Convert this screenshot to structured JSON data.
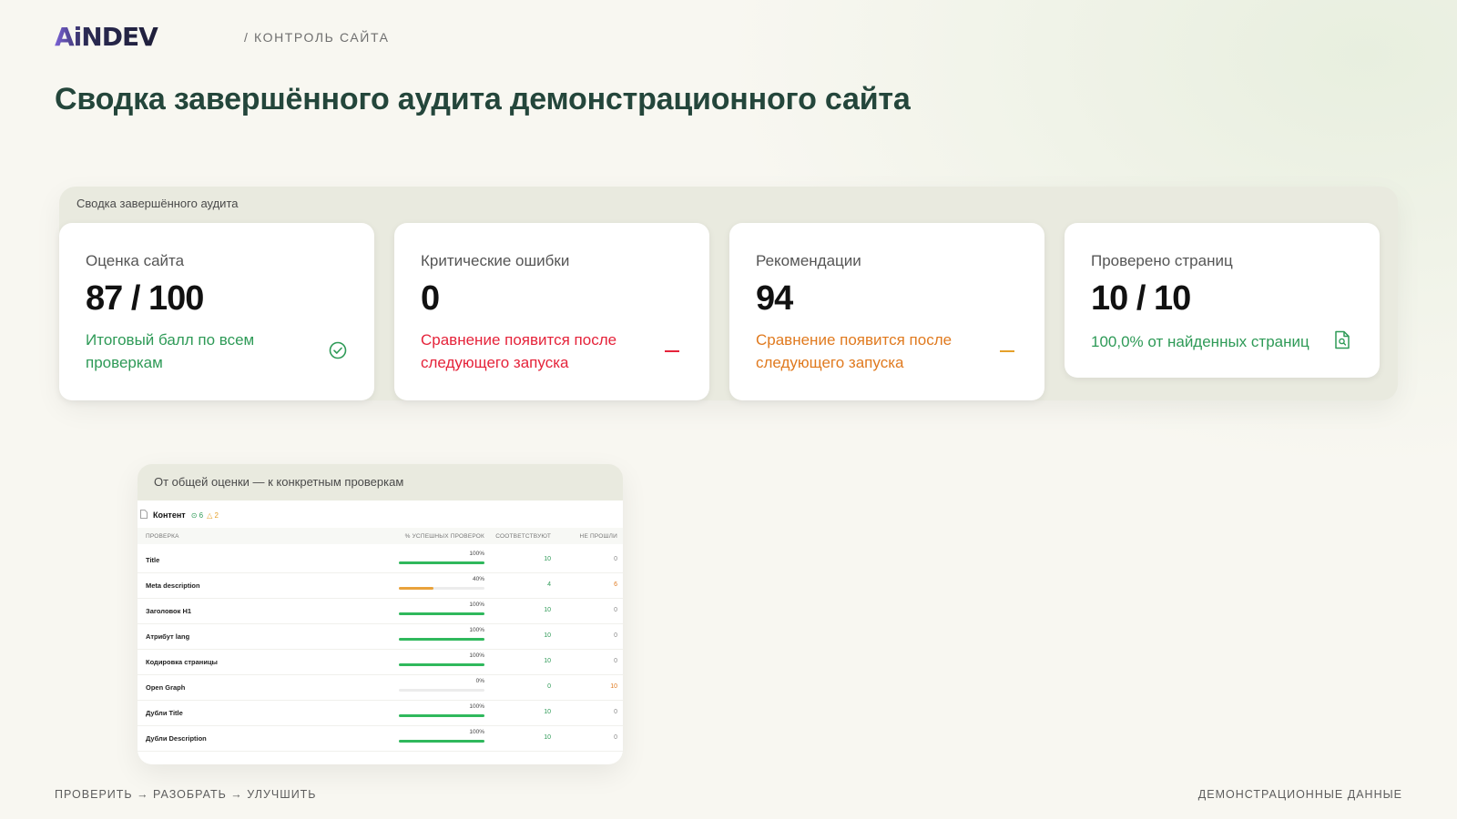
{
  "brand": {
    "logo_text": "AiNDEV",
    "section": "/ КОНТРОЛЬ САЙТА"
  },
  "page": {
    "title": "Сводка завершённого аудита демонстрационного сайта"
  },
  "summary": {
    "label": "Сводка завершённого аудита",
    "cards": [
      {
        "title": "Оценка сайта",
        "value": "87 / 100",
        "note": "Итоговый балл по всем проверкам",
        "icon": "check-circle-icon",
        "tone": "#2e9a57"
      },
      {
        "title": "Критические ошибки",
        "value": "0",
        "note": "Сравнение появится после следующего запуска",
        "icon": "dash-icon",
        "tone": "#e5233a"
      },
      {
        "title": "Рекомендации",
        "value": "94",
        "note": "Сравнение появится после следующего запуска",
        "icon": "dash-icon",
        "tone": "#e5a02a"
      },
      {
        "title": "Проверено страниц",
        "value": "10 / 10",
        "note": "100,0% от найденных страниц",
        "icon": "document-search-icon",
        "tone": "#2e9a57"
      }
    ]
  },
  "preview": {
    "label": "От общей оценки — к конкретным проверкам",
    "section": {
      "name": "Контент",
      "ok_count": "6",
      "warn_count": "2"
    },
    "columns": {
      "check": "Проверка",
      "percent": "% успешных проверок",
      "match": "Соответствуют",
      "fail": "Не прошли"
    },
    "rows": [
      {
        "name": "Title",
        "pct": "100%",
        "fill": 1.0,
        "match": "10",
        "fail": "0",
        "color": "#2fb85c"
      },
      {
        "name": "Meta description",
        "pct": "40%",
        "fill": 0.4,
        "match": "4",
        "fail": "6",
        "color": "#e9a23b"
      },
      {
        "name": "Заголовок H1",
        "pct": "100%",
        "fill": 1.0,
        "match": "10",
        "fail": "0",
        "color": "#2fb85c"
      },
      {
        "name": "Атрибут lang",
        "pct": "100%",
        "fill": 1.0,
        "match": "10",
        "fail": "0",
        "color": "#2fb85c"
      },
      {
        "name": "Кодировка страницы",
        "pct": "100%",
        "fill": 1.0,
        "match": "10",
        "fail": "0",
        "color": "#2fb85c"
      },
      {
        "name": "Open Graph",
        "pct": "0%",
        "fill": 0.0,
        "match": "0",
        "fail": "10",
        "color": "#2fb85c"
      },
      {
        "name": "Дубли Title",
        "pct": "100%",
        "fill": 1.0,
        "match": "10",
        "fail": "0",
        "color": "#2fb85c"
      },
      {
        "name": "Дубли Description",
        "pct": "100%",
        "fill": 1.0,
        "match": "10",
        "fail": "0",
        "color": "#2fb85c"
      }
    ]
  },
  "footer": {
    "left": "ПРОВЕРИТЬ → РАЗОБРАТЬ → УЛУЧШИТЬ",
    "right": "ДЕМОНСТРАЦИОННЫЕ ДАННЫЕ"
  }
}
